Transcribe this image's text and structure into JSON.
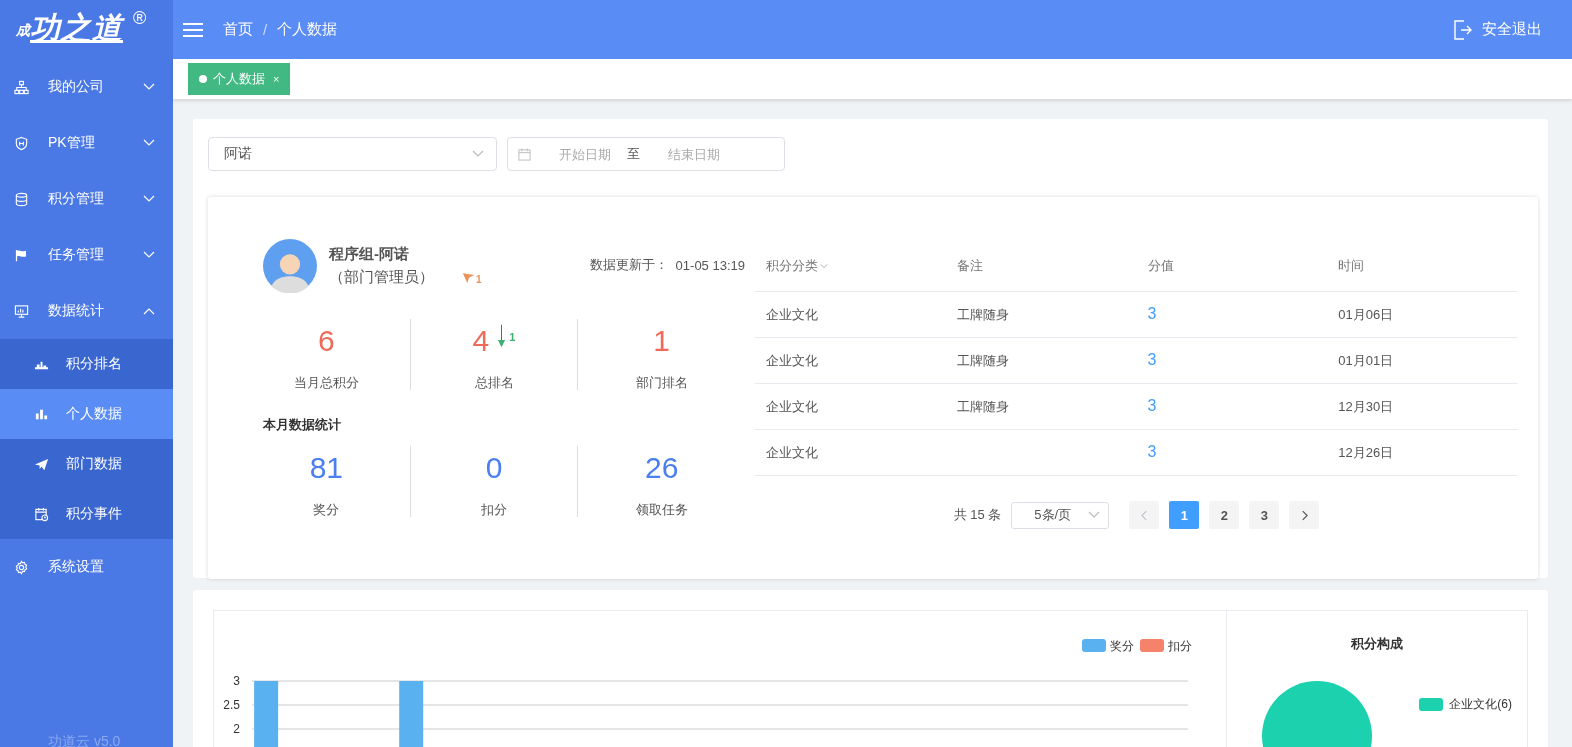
{
  "logo": {
    "prefix": "成",
    "text": "功之道",
    "mark": "®"
  },
  "sidebar": {
    "items": [
      {
        "label": "我的公司",
        "expanded": false
      },
      {
        "label": "PK管理",
        "expanded": false
      },
      {
        "label": "积分管理",
        "expanded": false
      },
      {
        "label": "任务管理",
        "expanded": false
      },
      {
        "label": "数据统计",
        "expanded": true,
        "children": [
          {
            "label": "积分排名",
            "selected": false
          },
          {
            "label": "个人数据",
            "selected": true
          },
          {
            "label": "部门数据",
            "selected": false
          },
          {
            "label": "积分事件",
            "selected": false
          }
        ]
      },
      {
        "label": "系统设置"
      }
    ],
    "version": "功道云 v5.0"
  },
  "header": {
    "breadcrumb": [
      "首页",
      "个人数据"
    ],
    "separator": "/",
    "logout": "安全退出"
  },
  "tabs": [
    {
      "label": "个人数据",
      "selected": true,
      "close": "×"
    }
  ],
  "filters": {
    "person": "阿诺",
    "start_placeholder": "开始日期",
    "range_separator": "至",
    "end_placeholder": "结束日期"
  },
  "profile": {
    "name": "程序组-阿诺",
    "role": "（部门管理员）",
    "level": "1",
    "updated_label": "数据更新于：",
    "updated_time": "01-05 13:19"
  },
  "stats": [
    {
      "value": "6",
      "label": "当月总积分"
    },
    {
      "value": "4",
      "label": "总排名",
      "change": "1"
    },
    {
      "value": "1",
      "label": "部门排名"
    }
  ],
  "monthly": {
    "title": "本月数据统计",
    "items": [
      {
        "value": "81",
        "label": "奖分"
      },
      {
        "value": "0",
        "label": "扣分"
      },
      {
        "value": "26",
        "label": "领取任务"
      }
    ]
  },
  "table": {
    "columns": [
      "积分分类",
      "备注",
      "分值",
      "时间"
    ],
    "rows": [
      [
        "企业文化",
        "工牌随身",
        "3",
        "01月06日"
      ],
      [
        "企业文化",
        "工牌随身",
        "3",
        "01月01日"
      ],
      [
        "企业文化",
        "工牌随身",
        "3",
        "12月30日"
      ],
      [
        "企业文化",
        "",
        "3",
        "12月26日"
      ]
    ]
  },
  "pagination": {
    "total": "共 15 条",
    "page_size": "5条/页",
    "prev_disabled": true,
    "next_disabled": false,
    "pages": [
      {
        "label": "1",
        "selected": true
      },
      {
        "label": "2",
        "selected": false
      },
      {
        "label": "3",
        "selected": false
      }
    ]
  },
  "bar_chart": {
    "chart_data": {
      "type": "bar",
      "ylim": [
        0,
        3
      ],
      "yticks": [
        2,
        2.5,
        3
      ],
      "stacked": false,
      "series": [
        {
          "name": "奖分",
          "color": "#5ab1ef",
          "values": [
            3,
            null,
            null,
            null,
            3,
            null,
            null,
            null,
            null,
            null,
            null,
            null,
            null,
            null,
            null,
            null,
            null,
            null,
            null,
            null,
            null,
            null,
            null,
            null,
            null,
            null
          ]
        },
        {
          "name": "扣分",
          "color": "#f5826b"
        }
      ]
    }
  },
  "pie_chart": {
    "chart_data": {
      "type": "pie",
      "title": "积分构成",
      "categories": [
        "企业文化(6)"
      ],
      "series": [
        {
          "color": "#1bd1ae",
          "values": [
            100
          ]
        }
      ]
    }
  }
}
